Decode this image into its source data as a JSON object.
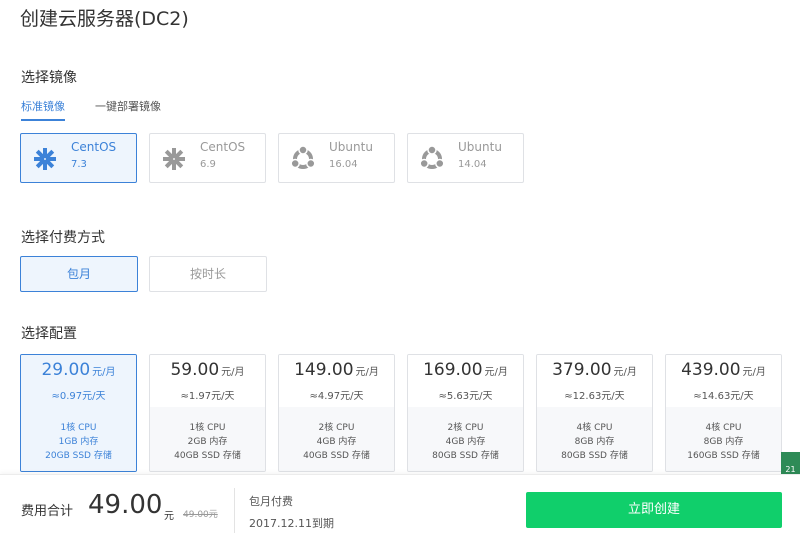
{
  "page": {
    "title": "创建云服务器(DC2)"
  },
  "image_section": {
    "title": "选择镜像",
    "tabs": [
      {
        "label": "标准镜像",
        "active": true
      },
      {
        "label": "一键部署镜像",
        "active": false
      }
    ],
    "images": [
      {
        "name": "CentOS",
        "version": "7.3",
        "icon": "centos-icon",
        "selected": true
      },
      {
        "name": "CentOS",
        "version": "6.9",
        "icon": "centos-icon",
        "selected": false
      },
      {
        "name": "Ubuntu",
        "version": "16.04",
        "icon": "ubuntu-icon",
        "selected": false
      },
      {
        "name": "Ubuntu",
        "version": "14.04",
        "icon": "ubuntu-icon",
        "selected": false
      }
    ]
  },
  "billing_section": {
    "title": "选择付费方式",
    "options": [
      {
        "label": "包月",
        "selected": true
      },
      {
        "label": "按时长",
        "selected": false
      }
    ]
  },
  "config_section": {
    "title": "选择配置",
    "plans": [
      {
        "price": "29.00",
        "unit": "元/月",
        "per_day": "≈0.97元/天",
        "cpu": "1核 CPU",
        "memory": "1GB 内存",
        "storage": "20GB SSD 存储",
        "selected": true
      },
      {
        "price": "59.00",
        "unit": "元/月",
        "per_day": "≈1.97元/天",
        "cpu": "1核 CPU",
        "memory": "2GB 内存",
        "storage": "40GB SSD 存储",
        "selected": false
      },
      {
        "price": "149.00",
        "unit": "元/月",
        "per_day": "≈4.97元/天",
        "cpu": "2核 CPU",
        "memory": "4GB 内存",
        "storage": "40GB SSD 存储",
        "selected": false
      },
      {
        "price": "169.00",
        "unit": "元/月",
        "per_day": "≈5.63元/天",
        "cpu": "2核 CPU",
        "memory": "4GB 内存",
        "storage": "80GB SSD 存储",
        "selected": false
      },
      {
        "price": "379.00",
        "unit": "元/月",
        "per_day": "≈12.63元/天",
        "cpu": "4核 CPU",
        "memory": "8GB 内存",
        "storage": "80GB SSD 存储",
        "selected": false
      },
      {
        "price": "439.00",
        "unit": "元/月",
        "per_day": "≈14.63元/天",
        "cpu": "4核 CPU",
        "memory": "8GB 内存",
        "storage": "160GB SSD 存储",
        "selected": false
      }
    ]
  },
  "footer": {
    "total_label": "费用合计",
    "total_amount": "49.00",
    "total_unit": "元",
    "original_price": "49.00元",
    "pay_type": "包月付费",
    "expire": "2017.12.11到期",
    "create_label": "立即创建"
  },
  "side_badge": "21",
  "colors": {
    "accent": "#3c82d8",
    "selected_bg": "#eef5fd",
    "create_button": "#10cf6b"
  }
}
